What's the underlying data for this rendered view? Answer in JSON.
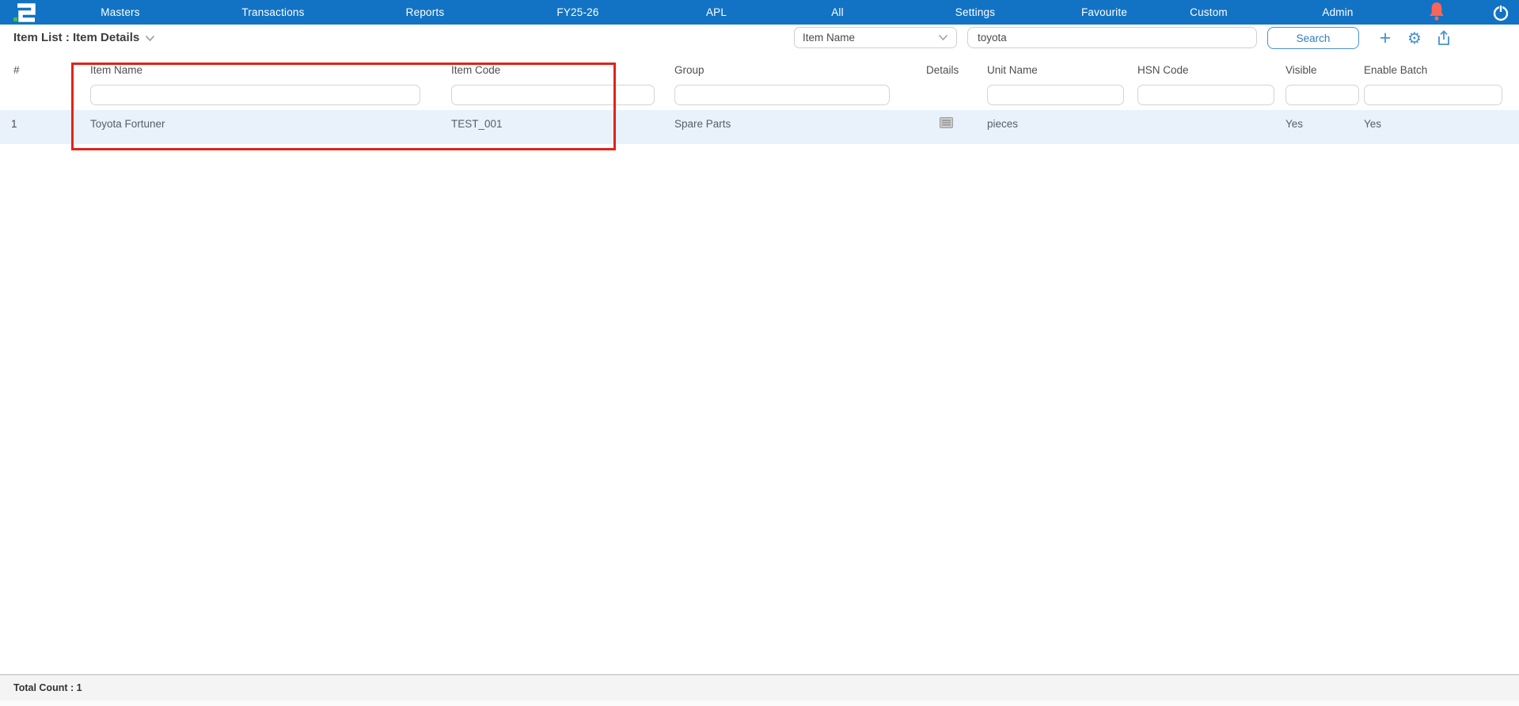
{
  "nav": {
    "items": [
      {
        "label": "Masters"
      },
      {
        "label": "Transactions"
      },
      {
        "label": "Reports"
      },
      {
        "label": "FY25-26"
      },
      {
        "label": "APL"
      },
      {
        "label": "All"
      },
      {
        "label": "Settings"
      },
      {
        "label": "Favourite"
      },
      {
        "label": "Custom"
      },
      {
        "label": "Admin"
      }
    ],
    "icons": {
      "logo": "brand-logo",
      "bell": "notification-bell",
      "power": "power-logout"
    }
  },
  "toolbar": {
    "title": "Item List : Item Details",
    "title_chevron_icon": "chevron-down",
    "search_column_selected": "Item Name",
    "search_value": "toyota",
    "search_button_label": "Search",
    "icons": {
      "plus": "add-new-item",
      "gear": "settings-gear",
      "share": "export-share"
    },
    "plus_glyph": "+",
    "gear_glyph": "⚙"
  },
  "table": {
    "headers": [
      "#",
      "Item Name",
      "Item Code",
      "Group",
      "Details",
      "Unit Name",
      "HSN Code",
      "Visible",
      "Enable Batch"
    ],
    "filters": {
      "item_name": "",
      "item_code": "",
      "group": "",
      "unit_name": "",
      "hsn_code": "",
      "visible": "",
      "enable_batch": ""
    },
    "rows": [
      {
        "index": "1",
        "item_name": "Toyota Fortuner",
        "item_code": "TEST_001",
        "group": "Spare Parts",
        "details_icon": "details-list",
        "unit_name": "pieces",
        "hsn_code": "",
        "visible": "Yes",
        "enable_batch": "Yes"
      }
    ]
  },
  "annotation": {
    "type": "highlight-box",
    "color": "#E2231A",
    "covers": "Item Name and Item Code columns"
  },
  "footer": {
    "total_count": "Total Count : 1"
  },
  "colors": {
    "navbar_blue": "#1273C4",
    "accent_blue": "#4A90D2",
    "bell_red": "#F8655A",
    "row_highlight": "#E9F1FB",
    "annotation_red": "#E2231A"
  }
}
